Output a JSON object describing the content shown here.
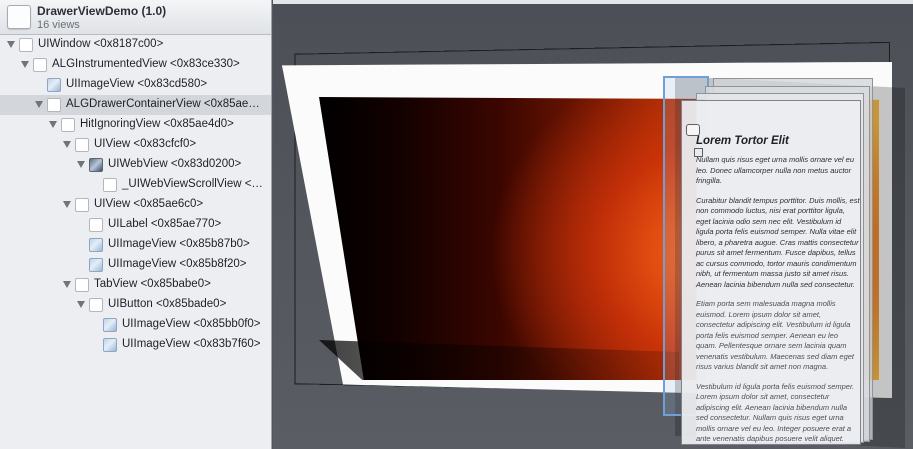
{
  "app": {
    "title": "DrawerViewDemo (1.0)",
    "views": "16 views"
  },
  "tree": [
    {
      "label": "UIWindow <0x8187c00>",
      "icon": "view-icon"
    },
    {
      "label": "ALGInstrumentedView <0x83ce330>",
      "icon": "view-icon"
    },
    {
      "label": "UIImageView <0x83cd580>",
      "icon": "image-view-icon"
    },
    {
      "label": "ALGDrawerContainerView <0x85ae…",
      "icon": "view-icon"
    },
    {
      "label": "HitIgnoringView <0x85ae4d0>",
      "icon": "view-icon"
    },
    {
      "label": "UIView <0x83cfcf0>",
      "icon": "view-icon"
    },
    {
      "label": "UIWebView <0x83d0200>",
      "icon": "web-view-icon"
    },
    {
      "label": "_UIWebViewScrollView <…",
      "icon": "view-icon"
    },
    {
      "label": "UIView <0x85ae6c0>",
      "icon": "view-icon"
    },
    {
      "label": "UILabel <0x85ae770>",
      "icon": "view-icon"
    },
    {
      "label": "UIImageView <0x85b87b0>",
      "icon": "image-view-icon"
    },
    {
      "label": "UIImageView <0x85b8f20>",
      "icon": "image-view-icon"
    },
    {
      "label": "TabView <0x85babe0>",
      "icon": "view-icon"
    },
    {
      "label": "UIButton <0x85bade0>",
      "icon": "view-icon"
    },
    {
      "label": "UIImageView <0x85bb0f0>",
      "icon": "image-view-icon"
    },
    {
      "label": "UIImageView <0x83b7f60>",
      "icon": "image-view-icon"
    }
  ],
  "preview": {
    "article_title": "Lorem Tortor Elit",
    "paragraphs": [
      "Nullam quis risus eget urna mollis ornare vel eu leo. Donec ullamcorper nulla non metus auctor fringilla.",
      "Curabitur blandit tempus porttitor. Duis mollis, est non commodo luctus, nisi erat porttitor ligula, eget lacinia odio sem nec elit. Vestibulum id ligula porta felis euismod semper. Nulla vitae elit libero, a pharetra augue. Cras mattis consectetur purus sit amet fermentum. Fusce dapibus, tellus ac cursus commodo, tortor mauris condimentum nibh, ut fermentum massa justo sit amet risus. Aenean lacinia bibendum nulla sed consectetur.",
      "Etiam porta sem malesuada magna mollis euismod. Lorem ipsum dolor sit amet, consectetur adipiscing elit. Vestibulum id ligula porta felis euismod semper. Aenean eu leo quam. Pellentesque ornare sem lacinia quam venenatis vestibulum. Maecenas sed diam eget risus varius blandit sit amet non magna.",
      "Vestibulum id ligula porta felis euismod semper. Lorem ipsum dolor sit amet, consectetur adipiscing elit. Aenean lacinia bibendum nulla sed consectetur. Nullam quis risus eget urna mollis ornare vel eu leo. Integer posuere erat a ante venenatis dapibus posuere velit aliquet."
    ]
  },
  "colors": {
    "selection": "#d3d6da",
    "canvas_background": "#52565c",
    "highlight_outline": "#6f9fd8"
  }
}
